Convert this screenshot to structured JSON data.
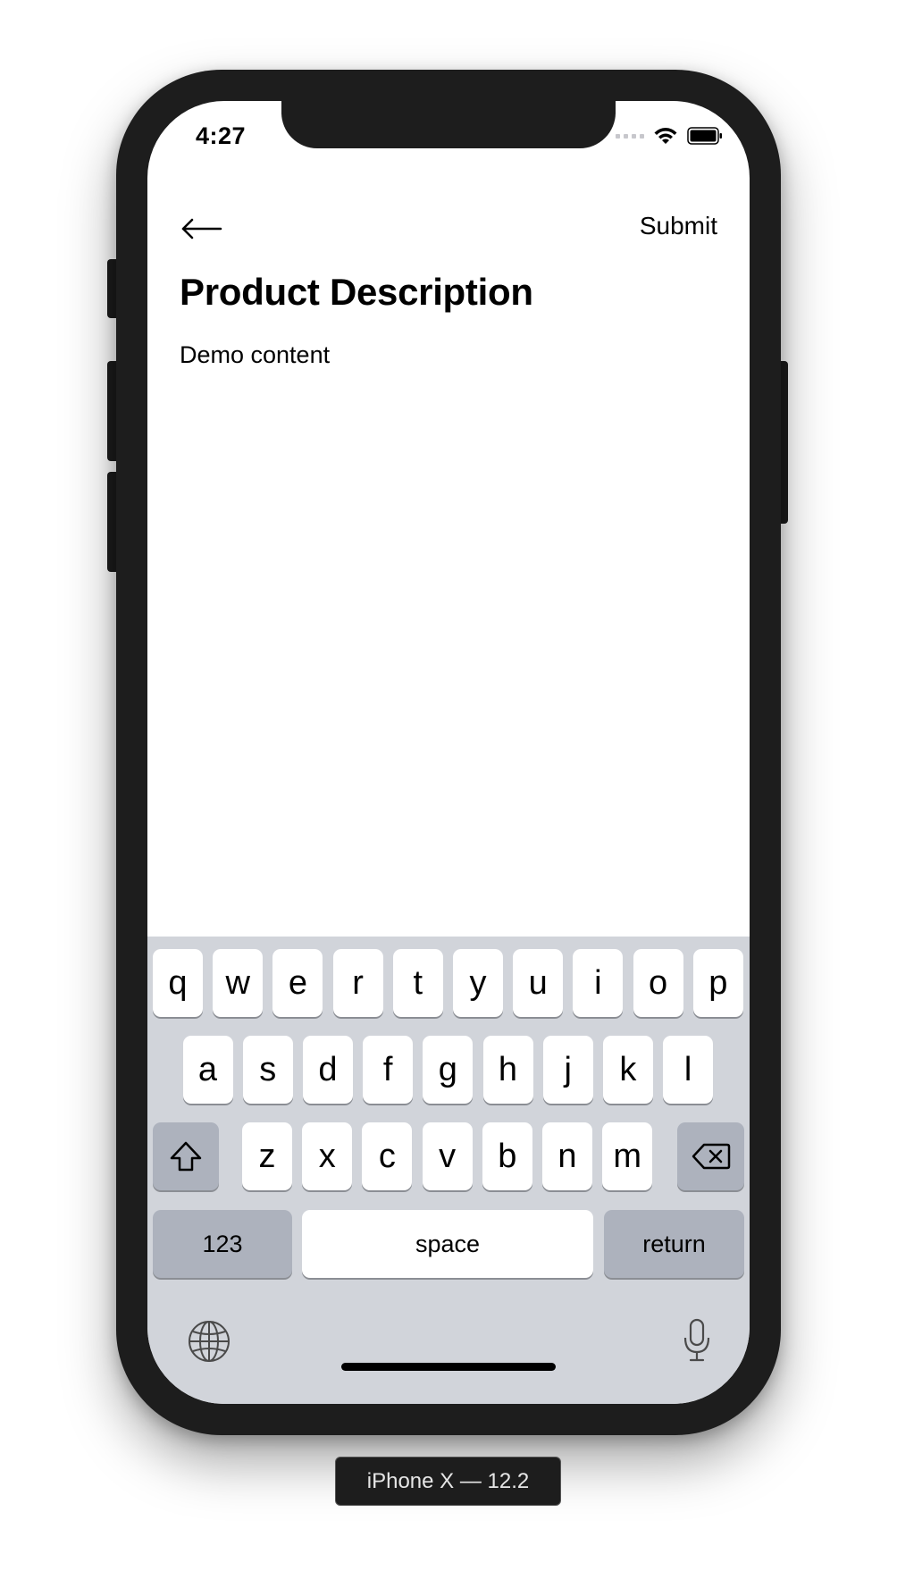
{
  "status_bar": {
    "time": "4:27",
    "icons": [
      "signal-icon",
      "wifi-icon",
      "battery-icon"
    ]
  },
  "nav": {
    "back_icon": "back-arrow-icon",
    "submit_label": "Submit"
  },
  "page": {
    "title": "Product Description",
    "content": "Demo content"
  },
  "keyboard": {
    "row1": [
      "q",
      "w",
      "e",
      "r",
      "t",
      "y",
      "u",
      "i",
      "o",
      "p"
    ],
    "row2": [
      "a",
      "s",
      "d",
      "f",
      "g",
      "h",
      "j",
      "k",
      "l"
    ],
    "row3": [
      "z",
      "x",
      "c",
      "v",
      "b",
      "n",
      "m"
    ],
    "shift_icon": "shift-icon",
    "delete_icon": "backspace-icon",
    "numbers_label": "123",
    "space_label": "space",
    "return_label": "return",
    "globe_icon": "globe-icon",
    "mic_icon": "microphone-icon"
  },
  "device_label": "iPhone X — 12.2",
  "colors": {
    "bezel": "#1d1d1d",
    "keyboard_bg": "#d1d4da",
    "key_light": "#ffffff",
    "key_dark": "#adb2bd"
  }
}
